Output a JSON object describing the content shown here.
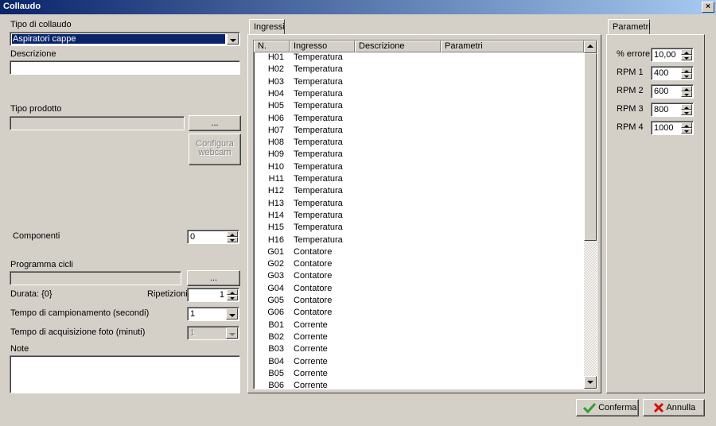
{
  "window": {
    "title": "Collaudo",
    "close_glyph": "×"
  },
  "left": {
    "tipo_collaudo_label": "Tipo di collaudo",
    "tipo_collaudo_value": "Aspiratori cappe",
    "descrizione_label": "Descrizione",
    "descrizione_value": "",
    "tipo_prodotto_label": "Tipo prodotto",
    "tipo_prodotto_value": "",
    "browse_label": "...",
    "configura_webcam_label": "Configura webcam",
    "componenti_label": "Componenti",
    "componenti_value": "0",
    "programma_cicli_label": "Programma cicli",
    "programma_cicli_value": "",
    "programma_browse_label": "...",
    "durata_label": "Durata: {0}",
    "ripetizioni_label": "Ripetizioni",
    "ripetizioni_value": "1",
    "campionamento_label": "Tempo di campionamento (secondi)",
    "campionamento_value": "1",
    "acquisizione_label": "Tempo di acquisizione foto (minuti)",
    "acquisizione_value": "1",
    "note_label": "Note",
    "note_value": ""
  },
  "ingressi": {
    "tab_label": "Ingressi",
    "columns": [
      "N.",
      "Ingresso",
      "Descrizione",
      "Parametri"
    ],
    "rows": [
      [
        "H01",
        "Temperatura"
      ],
      [
        "H02",
        "Temperatura"
      ],
      [
        "H03",
        "Temperatura"
      ],
      [
        "H04",
        "Temperatura"
      ],
      [
        "H05",
        "Temperatura"
      ],
      [
        "H06",
        "Temperatura"
      ],
      [
        "H07",
        "Temperatura"
      ],
      [
        "H08",
        "Temperatura"
      ],
      [
        "H09",
        "Temperatura"
      ],
      [
        "H10",
        "Temperatura"
      ],
      [
        "H11",
        "Temperatura"
      ],
      [
        "H12",
        "Temperatura"
      ],
      [
        "H13",
        "Temperatura"
      ],
      [
        "H14",
        "Temperatura"
      ],
      [
        "H15",
        "Temperatura"
      ],
      [
        "H16",
        "Temperatura"
      ],
      [
        "G01",
        "Contatore"
      ],
      [
        "G02",
        "Contatore"
      ],
      [
        "G03",
        "Contatore"
      ],
      [
        "G04",
        "Contatore"
      ],
      [
        "G05",
        "Contatore"
      ],
      [
        "G06",
        "Contatore"
      ],
      [
        "B01",
        "Corrente"
      ],
      [
        "B02",
        "Corrente"
      ],
      [
        "B03",
        "Corrente"
      ],
      [
        "B04",
        "Corrente"
      ],
      [
        "B05",
        "Corrente"
      ],
      [
        "B06",
        "Corrente"
      ]
    ]
  },
  "parametri": {
    "tab_label": "Parametri",
    "fields": [
      {
        "label": "% errore",
        "value": "10,00"
      },
      {
        "label": "RPM 1",
        "value": "400"
      },
      {
        "label": "RPM 2",
        "value": "600"
      },
      {
        "label": "RPM 3",
        "value": "800"
      },
      {
        "label": "RPM 4",
        "value": "1000"
      }
    ]
  },
  "buttons": {
    "conferma_label": "Conferma",
    "annulla_label": "Annulla"
  },
  "icons": {
    "conferma": "check-icon",
    "annulla": "x-icon",
    "colors": {
      "check": "#2fa12f",
      "x": "#d01010",
      "selection": "#0a246a"
    }
  }
}
